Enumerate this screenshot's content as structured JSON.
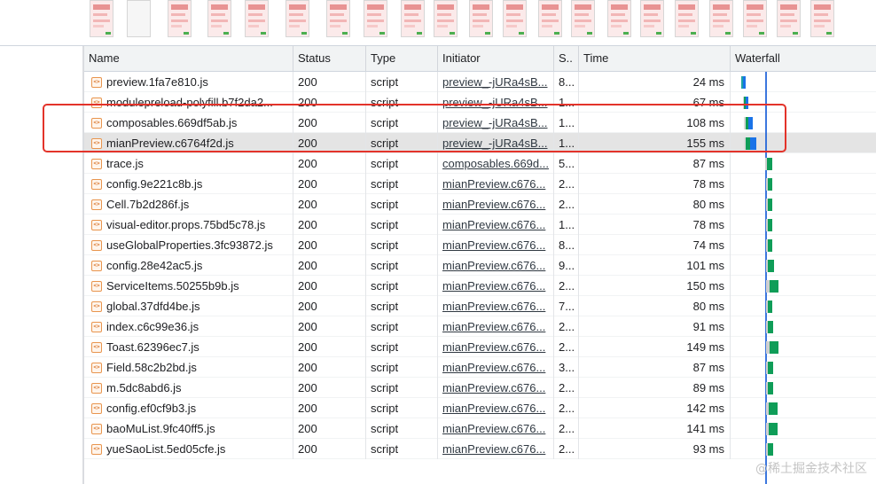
{
  "columns": {
    "name": "Name",
    "status": "Status",
    "type": "Type",
    "initiator": "Initiator",
    "size": "S..",
    "time": "Time",
    "waterfall": "Waterfall"
  },
  "file_icon": "js-file-icon",
  "rows": [
    {
      "name": "preview.1fa7e810.js",
      "status": "200",
      "type": "script",
      "initiator": "preview_-jURa4sB...",
      "size": "8...",
      "time": "24 ms"
    },
    {
      "name": "modulepreload-polyfill.b7f2da2...",
      "status": "200",
      "type": "script",
      "initiator": "preview_-jURa4sB...",
      "size": "1...",
      "time": "67 ms"
    },
    {
      "name": "composables.669df5ab.js",
      "status": "200",
      "type": "script",
      "initiator": "preview_-jURa4sB...",
      "size": "1...",
      "time": "108 ms"
    },
    {
      "name": "mianPreview.c6764f2d.js",
      "status": "200",
      "type": "script",
      "initiator": "preview_-jURa4sB...",
      "size": "1...",
      "time": "155 ms"
    },
    {
      "name": "trace.js",
      "status": "200",
      "type": "script",
      "initiator": "composables.669d...",
      "size": "5...",
      "time": "87 ms"
    },
    {
      "name": "config.9e221c8b.js",
      "status": "200",
      "type": "script",
      "initiator": "mianPreview.c676...",
      "size": "2...",
      "time": "78 ms"
    },
    {
      "name": "Cell.7b2d286f.js",
      "status": "200",
      "type": "script",
      "initiator": "mianPreview.c676...",
      "size": "2...",
      "time": "80 ms"
    },
    {
      "name": "visual-editor.props.75bd5c78.js",
      "status": "200",
      "type": "script",
      "initiator": "mianPreview.c676...",
      "size": "1...",
      "time": "78 ms"
    },
    {
      "name": "useGlobalProperties.3fc93872.js",
      "status": "200",
      "type": "script",
      "initiator": "mianPreview.c676...",
      "size": "8...",
      "time": "74 ms"
    },
    {
      "name": "config.28e42ac5.js",
      "status": "200",
      "type": "script",
      "initiator": "mianPreview.c676...",
      "size": "9...",
      "time": "101 ms"
    },
    {
      "name": "ServiceItems.50255b9b.js",
      "status": "200",
      "type": "script",
      "initiator": "mianPreview.c676...",
      "size": "2...",
      "time": "150 ms"
    },
    {
      "name": "global.37dfd4be.js",
      "status": "200",
      "type": "script",
      "initiator": "mianPreview.c676...",
      "size": "7...",
      "time": "80 ms"
    },
    {
      "name": "index.c6c99e36.js",
      "status": "200",
      "type": "script",
      "initiator": "mianPreview.c676...",
      "size": "2...",
      "time": "91 ms"
    },
    {
      "name": "Toast.62396ec7.js",
      "status": "200",
      "type": "script",
      "initiator": "mianPreview.c676...",
      "size": "2...",
      "time": "149 ms"
    },
    {
      "name": "Field.58c2b2bd.js",
      "status": "200",
      "type": "script",
      "initiator": "mianPreview.c676...",
      "size": "3...",
      "time": "87 ms"
    },
    {
      "name": "m.5dc8abd6.js",
      "status": "200",
      "type": "script",
      "initiator": "mianPreview.c676...",
      "size": "2...",
      "time": "89 ms"
    },
    {
      "name": "config.ef0cf9b3.js",
      "status": "200",
      "type": "script",
      "initiator": "mianPreview.c676...",
      "size": "2...",
      "time": "142 ms"
    },
    {
      "name": "baoMuList.9fc40ff5.js",
      "status": "200",
      "type": "script",
      "initiator": "mianPreview.c676...",
      "size": "2...",
      "time": "141 ms"
    },
    {
      "name": "yueSaoList.5ed05cfe.js",
      "status": "200",
      "type": "script",
      "initiator": "mianPreview.c676...",
      "size": "2...",
      "time": "93 ms"
    }
  ],
  "colors": {
    "header_bg": "#f1f3f4",
    "selected_row": "#e4e4e4",
    "highlight_border": "#e3332a",
    "waterfall_blue": "#1a73e8",
    "waterfall_green": "#0f9d58",
    "waterfall_teal": "#1ea4a4",
    "dom_line": "#1a5fd8"
  },
  "watermark": "@稀土掘金技术社区"
}
